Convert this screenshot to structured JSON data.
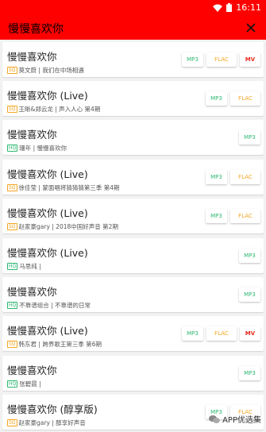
{
  "status": {
    "time": "16:11"
  },
  "appbar": {
    "title": "慢慢喜欢你"
  },
  "songs": [
    {
      "title": "慢慢喜欢你",
      "quality": "SQ",
      "artist": "莫文蔚 | 我们在中场相遇",
      "buttons": [
        "MP3",
        "FLAC",
        "MV"
      ]
    },
    {
      "title": "慢慢喜欢你 (Live)",
      "quality": "SQ",
      "artist": "王晰&郑云龙 | 声入人心 第4期",
      "buttons": [
        "MP3",
        "FLAC"
      ]
    },
    {
      "title": "慢慢喜欢你",
      "quality": "HQ",
      "artist": "珊年 | 慢慢喜欢你",
      "buttons": [
        "MP3"
      ]
    },
    {
      "title": "慢慢喜欢你 (Live)",
      "quality": "SQ",
      "artist": "徐佳莹 | 蒙面唱将猜猜猜第三季 第4期",
      "buttons": [
        "MP3",
        "FLAC"
      ]
    },
    {
      "title": "慢慢喜欢你 (Live)",
      "quality": "SQ",
      "artist": "赵家豪gary | 2018中国好声音 第2期",
      "buttons": [
        "MP3",
        "FLAC"
      ]
    },
    {
      "title": "慢慢喜欢你 (Live)",
      "quality": "HQ",
      "artist": "马思纯 |",
      "buttons": [
        "MP3"
      ]
    },
    {
      "title": "慢慢喜欢你",
      "quality": "HQ",
      "artist": "不靠谱组合 | 不靠谱的日常",
      "buttons": [
        "MP3"
      ]
    },
    {
      "title": "慢慢喜欢你 (Live)",
      "quality": "SQ",
      "artist": "韩东君 | 跨界歌王第三季 第6期",
      "buttons": [
        "MP3",
        "FLAC",
        "MV"
      ]
    },
    {
      "title": "慢慢喜欢你",
      "quality": "HQ",
      "artist": "张碧晨 |",
      "buttons": [
        "MP3"
      ]
    },
    {
      "title": "慢慢喜欢你 (醇享版)",
      "quality": "SQ",
      "artist": "赵家豪gary | 醇享好声音",
      "buttons": [
        "MP3",
        "FLAC"
      ]
    }
  ],
  "watermark": {
    "text": "APP优选集",
    "icon": "wechat-icon"
  },
  "colors": {
    "accent": "#ff0000",
    "mp3": "#2eb872",
    "flac": "#f5a623",
    "mv": "#e8291c"
  }
}
